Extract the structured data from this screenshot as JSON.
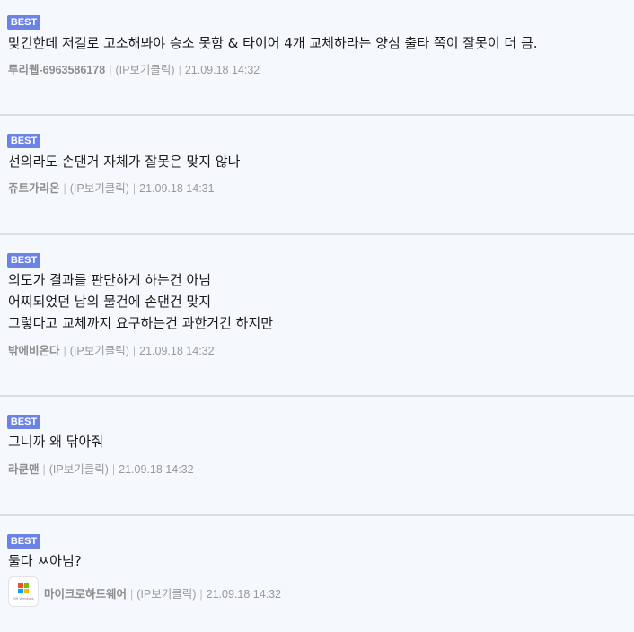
{
  "comments": [
    {
      "badge": "BEST",
      "lines": [
        "맞긴한데 저걸로 고소해봐야 승소 못함 & 타이어 4개 교체하라는 양심 출타 쪽이 잘못이 더 큼."
      ],
      "author": "루리웹-6963586178",
      "ip": "(IP보기클릭)",
      "date": "21.09.18 14:32"
    },
    {
      "badge": "BEST",
      "lines": [
        "선의라도 손댄거 자체가 잘못은 맞지 않나"
      ],
      "author": "쥬트가리온",
      "ip": "(IP보기클릭)",
      "date": "21.09.18 14:31"
    },
    {
      "badge": "BEST",
      "lines": [
        "의도가 결과를 판단하게 하는건 아님",
        "어찌되었던 남의 물건에 손댄건 맞지",
        "그렇다고 교체까지 요구하는건 과한거긴 하지만"
      ],
      "author": "밖에비온다",
      "ip": "(IP보기클릭)",
      "date": "21.09.18 14:32"
    },
    {
      "badge": "BEST",
      "lines": [
        "그니까 왜 닦아줘"
      ],
      "author": "라쿤맨",
      "ip": "(IP보기클릭)",
      "date": "21.09.18 14:32"
    },
    {
      "badge": "BEST",
      "lines": [
        "둘다 ㅆ아님?"
      ],
      "author": "마이크로하드웨어",
      "ip": "(IP보기클릭)",
      "date": "21.09.18 14:32",
      "avatar_caption": "MS Windows"
    }
  ]
}
